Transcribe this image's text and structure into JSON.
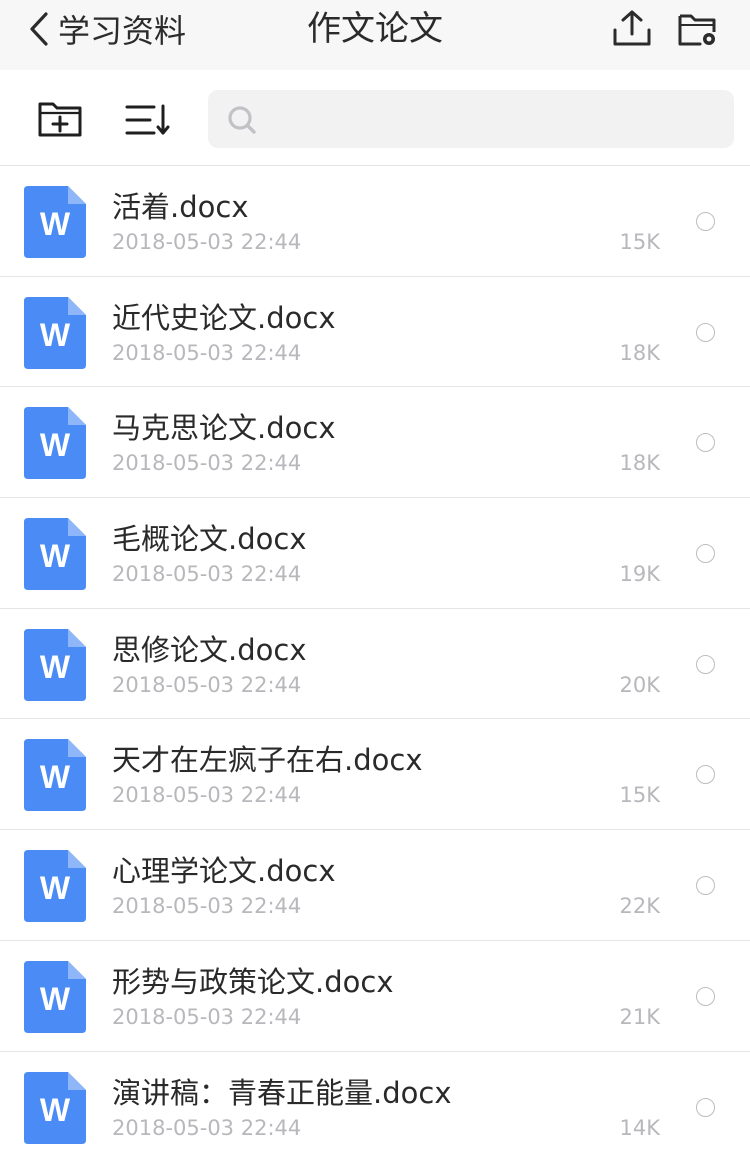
{
  "nav": {
    "back_label": "学习资料",
    "title": "作文论文",
    "back_icon": "chevron-left-icon",
    "upload_icon": "upload-icon",
    "folder_settings_icon": "folder-settings-icon"
  },
  "toolbar": {
    "new_folder_icon": "folder-plus-icon",
    "sort_icon": "sort-icon",
    "search": {
      "placeholder": "",
      "value": ""
    }
  },
  "colors": {
    "accent": "#4a8bf5",
    "nav_bg": "#f7f7f8",
    "meta_text": "#b8b8bc"
  },
  "files": [
    {
      "name": "活着.docx",
      "date": "2018-05-03 22:44",
      "size": "15K",
      "icon_letter": "W"
    },
    {
      "name": "近代史论文.docx",
      "date": "2018-05-03 22:44",
      "size": "18K",
      "icon_letter": "W"
    },
    {
      "name": "马克思论文.docx",
      "date": "2018-05-03 22:44",
      "size": "18K",
      "icon_letter": "W"
    },
    {
      "name": "毛概论文.docx",
      "date": "2018-05-03 22:44",
      "size": "19K",
      "icon_letter": "W"
    },
    {
      "name": "思修论文.docx",
      "date": "2018-05-03 22:44",
      "size": "20K",
      "icon_letter": "W"
    },
    {
      "name": "天才在左疯子在右.docx",
      "date": "2018-05-03 22:44",
      "size": "15K",
      "icon_letter": "W"
    },
    {
      "name": "心理学论文.docx",
      "date": "2018-05-03 22:44",
      "size": "22K",
      "icon_letter": "W"
    },
    {
      "name": "形势与政策论文.docx",
      "date": "2018-05-03 22:44",
      "size": "21K",
      "icon_letter": "W"
    },
    {
      "name": "演讲稿：青春正能量.docx",
      "date": "2018-05-03 22:44",
      "size": "14K",
      "icon_letter": "W"
    }
  ]
}
